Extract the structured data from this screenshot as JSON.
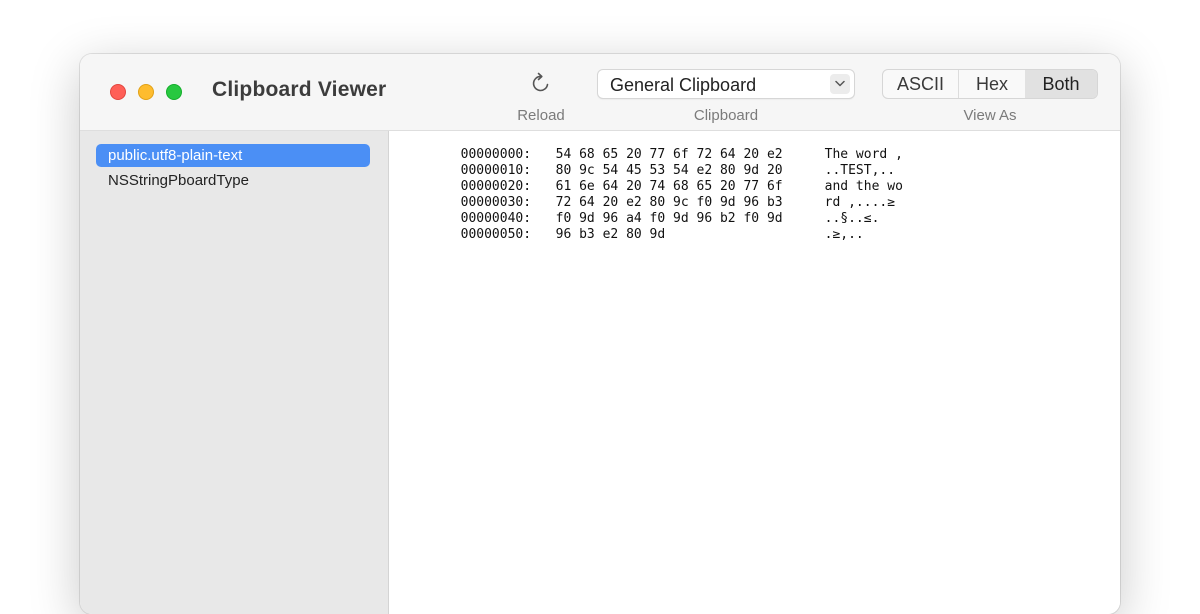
{
  "window": {
    "title": "Clipboard Viewer"
  },
  "toolbar": {
    "reload_label": "Reload",
    "reload_icon": "reload-icon",
    "clipboard_label": "Clipboard",
    "clipboard_value": "General Clipboard",
    "view_as_label": "View As",
    "view_as_options": [
      "ASCII",
      "Hex",
      "Both"
    ],
    "view_as_selected": "Both"
  },
  "sidebar": {
    "items": [
      {
        "label": "public.utf8-plain-text",
        "selected": true
      },
      {
        "label": "NSStringPboardType",
        "selected": false
      }
    ]
  },
  "hex_dump": {
    "rows": [
      {
        "offset": "00000000:",
        "hex": "54 68 65 20 77 6f 72 64 20 e2",
        "ascii": "The word ,"
      },
      {
        "offset": "00000010:",
        "hex": "80 9c 54 45 53 54 e2 80 9d 20",
        "ascii": "..TEST,.."
      },
      {
        "offset": "00000020:",
        "hex": "61 6e 64 20 74 68 65 20 77 6f",
        "ascii": "and the wo"
      },
      {
        "offset": "00000030:",
        "hex": "72 64 20 e2 80 9c f0 9d 96 b3",
        "ascii": "rd ,....≥"
      },
      {
        "offset": "00000040:",
        "hex": "f0 9d 96 a4 f0 9d 96 b2 f0 9d",
        "ascii": "..§..≤."
      },
      {
        "offset": "00000050:",
        "hex": "96 b3 e2 80 9d",
        "ascii": ".≥,.."
      }
    ]
  },
  "colors": {
    "selection": "#4b8ff5",
    "close": "#ff5f57",
    "minimize": "#febc2e",
    "zoom": "#28c840"
  }
}
